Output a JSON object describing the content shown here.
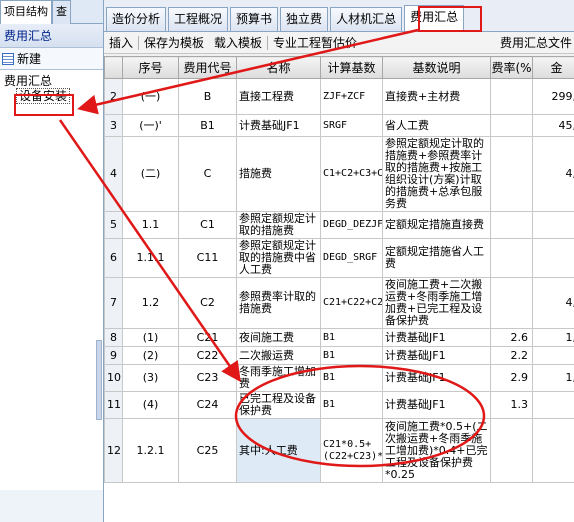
{
  "left": {
    "tabs": [
      "项目结构",
      "查"
    ],
    "title": "费用汇总",
    "new_label": "新建",
    "tree_root": "费用汇总",
    "tree_child": "设备安装"
  },
  "tabs": [
    "造价分析",
    "工程概况",
    "预算书",
    "独立费",
    "人材机汇总",
    "费用汇总"
  ],
  "active_tab": "费用汇总",
  "toolbar": {
    "insert": "插入",
    "save_template": "保存为模板",
    "load_template": "载入模板",
    "special_fee": "专业工程暂估价",
    "right_label": "费用汇总文件"
  },
  "table": {
    "headers": [
      "",
      "序号",
      "费用代号",
      "名称",
      "计算基数",
      "基数说明",
      "费率(%",
      "金"
    ],
    "rows": [
      {
        "rn": "2",
        "seq": "(一)",
        "code": "B",
        "name": "直接工程费",
        "base": "ZJF+ZCF",
        "desc": "直接费+主材费",
        "rate": "",
        "amt": "299,"
      },
      {
        "rn": "3",
        "seq": "(一)'",
        "code": "B1",
        "name": "计费基础JF1",
        "base": "SRGF",
        "desc": "省人工费",
        "rate": "",
        "amt": "45,"
      },
      {
        "rn": "4",
        "seq": "(二)",
        "code": "C",
        "name": "措施费",
        "base": "C1+C2+C3+C4",
        "desc": "参照定额规定计取的措施费+参照费率计取的措施费+按施工组织设计(方案)计取的措施费+总承包服务费",
        "rate": "",
        "amt": "4,"
      },
      {
        "rn": "5",
        "seq": "1.1",
        "code": "C1",
        "name": "参照定额规定计取的措施费",
        "base": "DEGD_DEZJF",
        "desc": "定额规定措施直接费",
        "rate": "",
        "amt": ""
      },
      {
        "rn": "6",
        "seq": "1.1.1",
        "code": "C11",
        "name": "参照定额规定计取的措施费中省人工费",
        "base": "DEGD_SRGF",
        "desc": "定额规定措施省人工费",
        "rate": "",
        "amt": ""
      },
      {
        "rn": "7",
        "seq": "1.2",
        "code": "C2",
        "name": "参照费率计取的措施费",
        "base": "C21+C22+C23+C24",
        "desc": "夜间施工费+二次搬运费+冬雨季施工增加费+已完工程及设备保护费",
        "rate": "",
        "amt": "4,"
      },
      {
        "rn": "8",
        "seq": "(1)",
        "code": "C21",
        "name": "夜间施工费",
        "base": "B1",
        "desc": "计费基础JF1",
        "rate": "2.6",
        "amt": "1,"
      },
      {
        "rn": "9",
        "seq": "(2)",
        "code": "C22",
        "name": "二次搬运费",
        "base": "B1",
        "desc": "计费基础JF1",
        "rate": "2.2",
        "amt": ""
      },
      {
        "rn": "10",
        "seq": "(3)",
        "code": "C23",
        "name": "冬雨季施工增加费",
        "base": "B1",
        "desc": "计费基础JF1",
        "rate": "2.9",
        "amt": "1,"
      },
      {
        "rn": "11",
        "seq": "(4)",
        "code": "C24",
        "name": "已完工程及设备保护费",
        "base": "B1",
        "desc": "计费基础JF1",
        "rate": "1.3",
        "amt": ""
      },
      {
        "rn": "12",
        "seq": "1.2.1",
        "code": "C25",
        "name": "其中:人工费",
        "base": "C21*0.5+(C22+C23)*0.4+C24*0.25",
        "desc": "夜间施工费*0.5+(二次搬运费+冬雨季施工增加费)*0.4+已完工程及设备保护费*0.25",
        "rate": "",
        "amt": ""
      }
    ]
  },
  "colors": {
    "annotation": "#e01818",
    "highlight": "#dfeaf7"
  }
}
